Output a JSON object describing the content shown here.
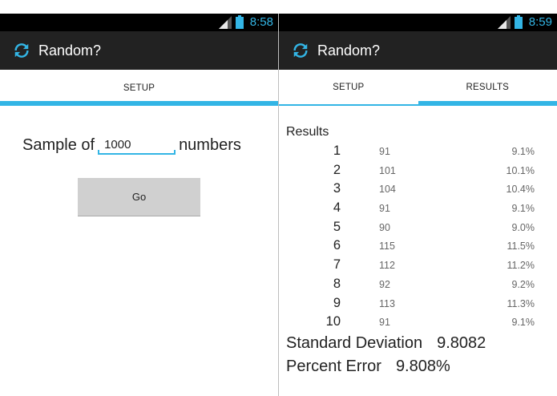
{
  "left": {
    "status": {
      "time": "8:58"
    },
    "app_title": "Random?",
    "tabs": [
      {
        "label": "SETUP",
        "selected": true
      }
    ],
    "sample": {
      "prefix": "Sample of",
      "value": "1000",
      "suffix": "numbers"
    },
    "go_label": "Go"
  },
  "right": {
    "status": {
      "time": "8:59"
    },
    "app_title": "Random?",
    "tabs": [
      {
        "label": "SETUP",
        "selected": false
      },
      {
        "label": "RESULTS",
        "selected": true
      }
    ],
    "results_title": "Results",
    "results": [
      {
        "index": "1",
        "count": "91",
        "percent": "9.1%"
      },
      {
        "index": "2",
        "count": "101",
        "percent": "10.1%"
      },
      {
        "index": "3",
        "count": "104",
        "percent": "10.4%"
      },
      {
        "index": "4",
        "count": "91",
        "percent": "9.1%"
      },
      {
        "index": "5",
        "count": "90",
        "percent": "9.0%"
      },
      {
        "index": "6",
        "count": "115",
        "percent": "11.5%"
      },
      {
        "index": "7",
        "count": "112",
        "percent": "11.2%"
      },
      {
        "index": "8",
        "count": "92",
        "percent": "9.2%"
      },
      {
        "index": "9",
        "count": "113",
        "percent": "11.3%"
      },
      {
        "index": "10",
        "count": "91",
        "percent": "9.1%"
      }
    ],
    "std_dev": {
      "label": "Standard Deviation",
      "value": "9.8082"
    },
    "percent_error": {
      "label": "Percent Error",
      "value": "9.808%"
    }
  },
  "colors": {
    "accent": "#33b5e5",
    "action_bar": "#222222",
    "button": "#d0d0d0"
  },
  "icons": {
    "app": "refresh-icon",
    "signal": "signal-icon",
    "battery": "battery-icon"
  }
}
